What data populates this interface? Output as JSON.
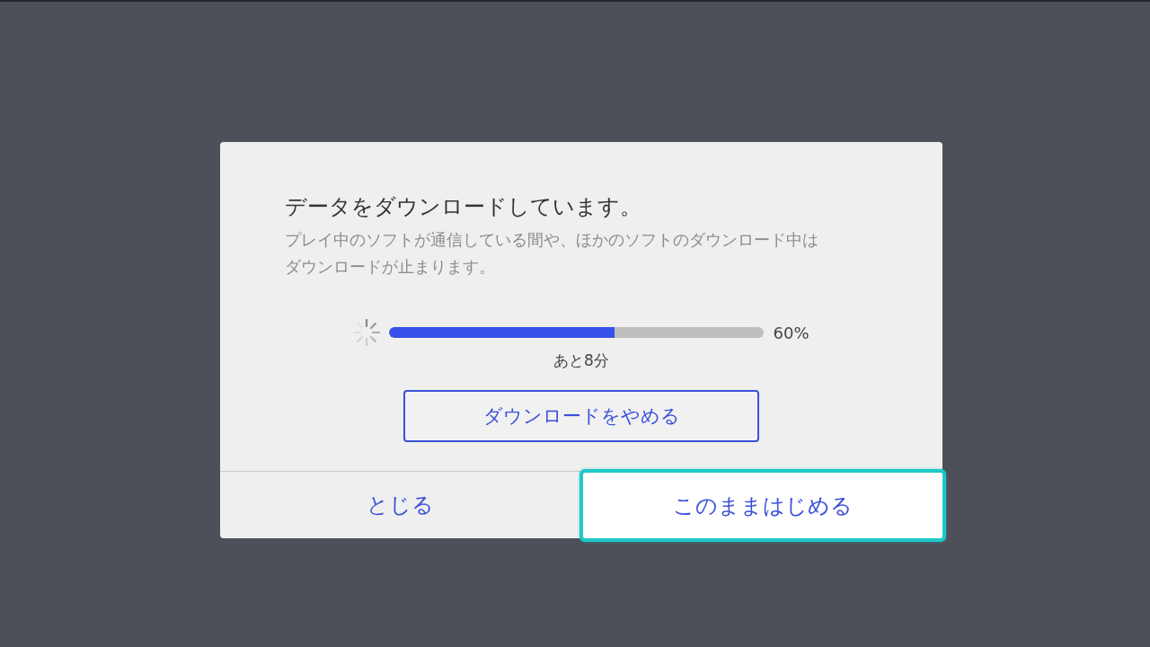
{
  "dialog": {
    "title": "データをダウンロードしています。",
    "message": "プレイ中のソフトが通信している間や、ほかのソフトのダウンロード中はダウンロードが止まります。",
    "progress": {
      "level": 0.6,
      "percent": "60%",
      "remaining": "あと8分"
    },
    "cancel_button": "ダウンロードをやめる",
    "actions": [
      {
        "label": "とじる",
        "selected": false
      },
      {
        "label": "このままはじめる",
        "selected": true
      }
    ]
  }
}
